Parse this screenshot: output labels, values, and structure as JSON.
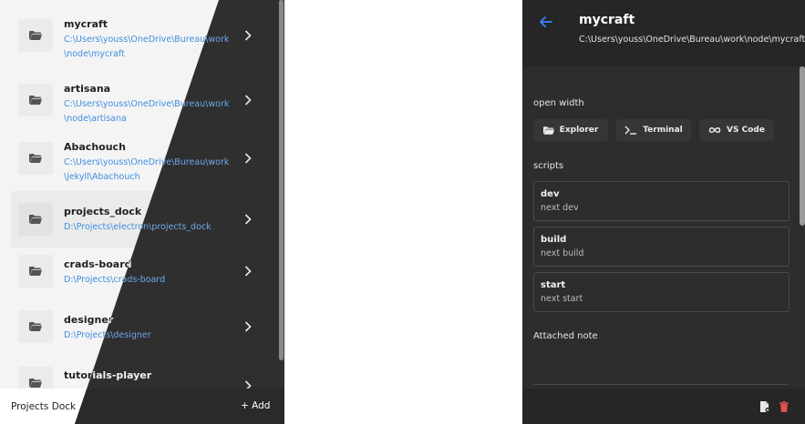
{
  "left": {
    "projects": [
      {
        "name": "mycraft",
        "path_lines": [
          "C:\\Users\\youss\\OneDrive\\Bureau\\work",
          "\\node\\mycraft"
        ]
      },
      {
        "name": "artisana",
        "path_lines": [
          "C:\\Users\\youss\\OneDrive\\Bureau\\work",
          "\\node\\artisana"
        ]
      },
      {
        "name": "Abachouch",
        "path_lines": [
          "C:\\Users\\youss\\OneDrive\\Bureau\\work",
          "\\jekyll\\Abachouch"
        ]
      },
      {
        "name": "projects_dock",
        "path_lines": [
          "D:\\Projects\\electron\\projects_dock"
        ]
      },
      {
        "name": "crads-board",
        "path_lines": [
          "D:\\Projects\\crads-board"
        ]
      },
      {
        "name": "designer",
        "path_lines": [
          "D:\\Projects\\designer"
        ]
      },
      {
        "name": "tutorials-player",
        "path_lines": [
          ""
        ]
      }
    ],
    "footer": {
      "brand": "Projects Dock",
      "add_label": "+ Add"
    }
  },
  "right": {
    "title": "mycraft",
    "path": "C:\\Users\\youss\\OneDrive\\Bureau\\work\\node\\mycraft",
    "open_with_label": "open width",
    "open_buttons": [
      {
        "label": "Explorer",
        "icon": "folder-open-icon"
      },
      {
        "label": "Terminal",
        "icon": "terminal-icon"
      },
      {
        "label": "VS Code",
        "icon": "infinity-icon"
      }
    ],
    "scripts_label": "scripts",
    "scripts": [
      {
        "name": "dev",
        "command": "next dev"
      },
      {
        "name": "build",
        "command": "next build"
      },
      {
        "name": "start",
        "command": "next start"
      }
    ],
    "attached_note_label": "Attached note",
    "footer_icons": [
      "copy-file-icon",
      "trash-icon"
    ]
  },
  "colors": {
    "dark_bg": "#2d2d2d",
    "link_blue": "#3e8ee0",
    "accent_blue": "#3b82f6",
    "danger_red": "#e05252"
  }
}
